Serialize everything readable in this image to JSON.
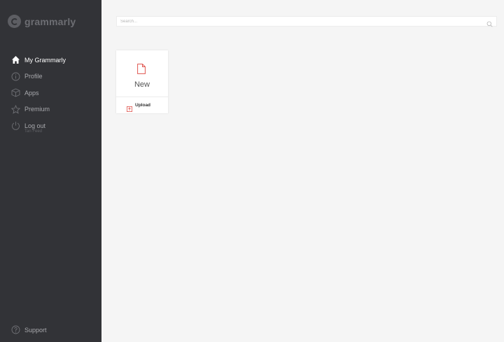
{
  "app": {
    "logo_text": "grammarly"
  },
  "sidebar": {
    "items": [
      {
        "label": "My Grammarly",
        "icon": "home-icon",
        "active": true
      },
      {
        "label": "Profile",
        "icon": "info-icon"
      },
      {
        "label": "Apps",
        "icon": "box-icon"
      },
      {
        "label": "Premium",
        "icon": "star-icon"
      },
      {
        "label": "Log out",
        "icon": "power-icon",
        "sub": "Tan Feed"
      }
    ],
    "support_label": "Support"
  },
  "search": {
    "placeholder": "Search..."
  },
  "card": {
    "new_label": "New",
    "upload_label": "Upload"
  },
  "colors": {
    "sidebar_bg": "#323337",
    "accent": "#e0554f",
    "main_bg": "#f5f5f5"
  }
}
